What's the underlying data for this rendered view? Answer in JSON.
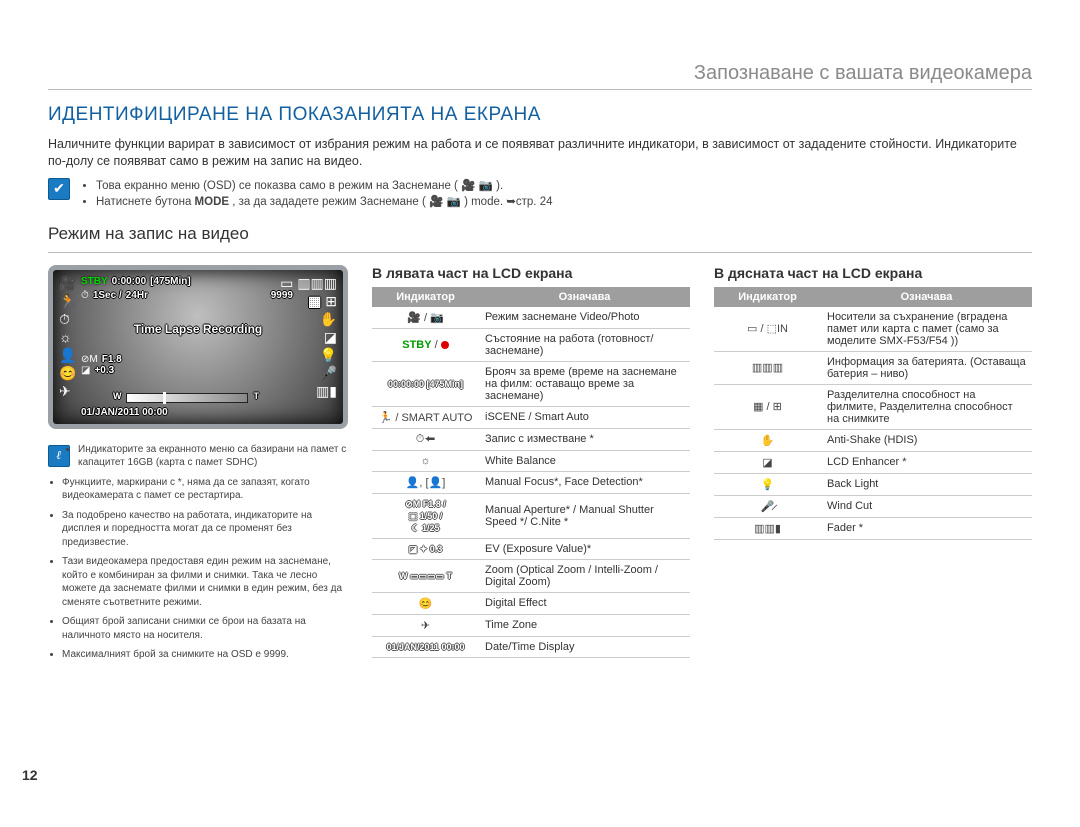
{
  "header": {
    "breadcrumb": "Запознаване с вашата видеокамера"
  },
  "title": "ИДЕНТИФИЦИРАНЕ НА ПОКАЗАНИЯТА НА ЕКРАНА",
  "intro": "Наличните функции варират в зависимост от избрания режим на работа и се появяват различните индикатори, в зависимост от зададените стойности. Индикаторите по-долу се появяват само в режим на запис на видео.",
  "tips": {
    "line1_a": "Това екранно меню (OSD) се показва само в режим на Заснемане (",
    "line1_b": ").",
    "line2_a": "Натиснете бутона ",
    "line2_mode": "MODE",
    "line2_b": ", за да зададете режим Заснемане (",
    "line2_c": ") mode. ➥стр. 24"
  },
  "subsection": "Режим на запис на видео",
  "lcd": {
    "stby": "STBY",
    "time": "0:00:00",
    "remain": "[475Min]",
    "interval": "1Sec /",
    "period": "24Hr",
    "shots": "9999",
    "center": "Time Lapse Recording",
    "aperture": "F1.8",
    "ev": "+0.3",
    "date": "01/JAN/2011 00:00",
    "zoom_w": "W",
    "zoom_t": "T"
  },
  "notes": [
    "Индикаторите за екранното меню са базирани на памет с капацитет 16GB (карта с памет SDHC)",
    "Функциите, маркирани с *, няма да се запазят, когато видеокамерата с памет се рестартира.",
    "За подобрено качество на работата, индикаторите на дисплея и поредността могат да се променят без предизвестие.",
    "Тази видеокамера предоставя един режим на заснемане, който е комбиниран за филми и снимки. Така че лесно можете да заснемате филми и снимки в един режим, без да сменяте съответните режими.",
    "Общият брой записани снимки се брои на базата на наличното място на носителя.",
    "Максималният брой за снимките на OSD е 9999."
  ],
  "leftTable": {
    "title": "В лявата част на LCD екрана",
    "head_indicator": "Индикатор",
    "head_meaning": "Означава",
    "rows": [
      {
        "icon": "🎥 / 📷",
        "text": "Режим заснемане Video/Photo"
      },
      {
        "iconHtml": "stby_red",
        "text": "Състояние на работа (готовност/заснемане)"
      },
      {
        "iconHtml": "time_label",
        "text": "Брояч за време (време на заснемане на филм: оставащо време за заснемане)"
      },
      {
        "icon": "🏃 / SMART AUTO",
        "text": "iSCENE / Smart Auto"
      },
      {
        "icon": "⏱⬅",
        "text": "Запис с изместване *"
      },
      {
        "icon": "☼",
        "text": "White Balance"
      },
      {
        "icon": "👤, [👤]",
        "text": "Manual Focus*, Face Detection*"
      },
      {
        "iconHtml": "aperture_group",
        "text": "Manual Aperture* / Manual Shutter Speed */ C.Nite *"
      },
      {
        "iconHtml": "ev_label",
        "text": "EV (Exposure Value)*"
      },
      {
        "iconHtml": "zoom",
        "text": "Zoom (Optical Zoom / Intelli-Zoom / Digital Zoom)"
      },
      {
        "icon": "😊",
        "text": "Digital Effect"
      },
      {
        "icon": "✈",
        "text": "Time Zone"
      },
      {
        "iconHtml": "date_label",
        "text": "Date/Time Display"
      }
    ]
  },
  "rightTable": {
    "title": "В дясната част на LCD екрана",
    "head_indicator": "Индикатор",
    "head_meaning": "Означава",
    "rows": [
      {
        "icon": "▭ / ⬚IN",
        "text": "Носители за съхранение (вградена памет или карта с памет (само за моделите SMX-F53/F54 ))"
      },
      {
        "icon": "▥▥▥",
        "text": "Информация за батерията. (Оставаща батерия – ниво)"
      },
      {
        "icon": "▦ / ⊞",
        "text": "Разделителна способност на филмите, Разделителна способност на снимките"
      },
      {
        "icon": "✋",
        "text": "Anti-Shake (HDIS)"
      },
      {
        "icon": "◪",
        "text": "LCD Enhancer *"
      },
      {
        "icon": "💡",
        "text": "Back Light"
      },
      {
        "icon": "🎤̷",
        "text": "Wind Cut"
      },
      {
        "icon": "▥▥▮",
        "text": "Fader *"
      }
    ]
  },
  "pageNumber": "12",
  "labels": {
    "aperture_icon": "⊘M F1.8 /",
    "shutter_icon": "⬚ 1/50 /",
    "cnite_icon": "☾ 1/25",
    "ev_icon": "◪ ✦ 0.3",
    "time_icon": "00:00:00 [475Min]",
    "date_icon": "01/JAN/2011 00:00",
    "stby_text": "STBY",
    "zoom_w": "W",
    "zoom_t": "T"
  }
}
